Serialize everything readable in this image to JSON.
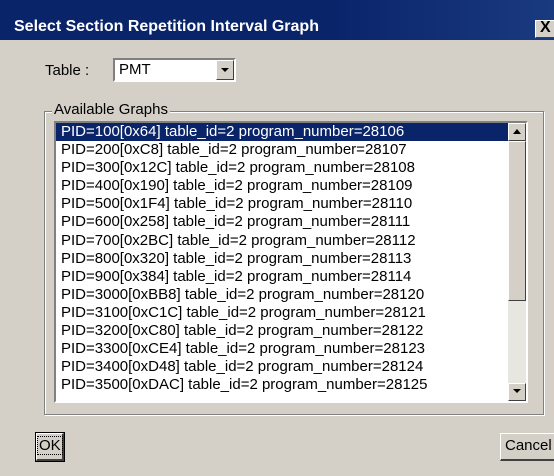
{
  "window": {
    "title": "Select Section Repetition Interval Graph",
    "close_label": "X"
  },
  "table": {
    "label": "Table :",
    "value": "PMT"
  },
  "graphs": {
    "group_label": "Available Graphs",
    "selected_index": 0,
    "items": [
      "PID=100[0x64] table_id=2 program_number=28106",
      "PID=200[0xC8] table_id=2 program_number=28107",
      "PID=300[0x12C] table_id=2 program_number=28108",
      "PID=400[0x190] table_id=2 program_number=28109",
      "PID=500[0x1F4] table_id=2 program_number=28110",
      "PID=600[0x258] table_id=2 program_number=28111",
      "PID=700[0x2BC] table_id=2 program_number=28112",
      "PID=800[0x320] table_id=2 program_number=28113",
      "PID=900[0x384] table_id=2 program_number=28114",
      "PID=3000[0xBB8] table_id=2 program_number=28120",
      "PID=3100[0xC1C] table_id=2 program_number=28121",
      "PID=3200[0xC80] table_id=2 program_number=28122",
      "PID=3300[0xCE4] table_id=2 program_number=28123",
      "PID=3400[0xD48] table_id=2 program_number=28124",
      "PID=3500[0xDAC] table_id=2 program_number=28125"
    ]
  },
  "buttons": {
    "ok_label": "OK",
    "cancel_label": "Cancel"
  },
  "colors": {
    "titlebar": "#0a246a",
    "dialog_bg": "#d4d0c8",
    "selection": "#0a246a"
  }
}
